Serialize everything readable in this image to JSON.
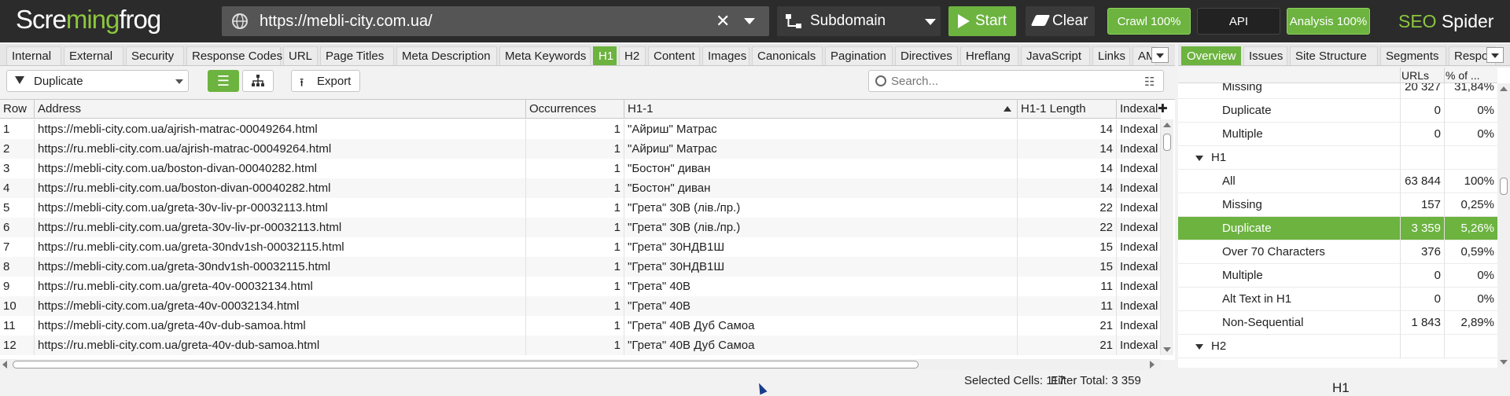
{
  "app": {
    "logo_left": "Scre",
    "logo_frog": "ming",
    "logo_right": "frog",
    "brand_seo": "SEO",
    "brand_spider": " Spider"
  },
  "topbar": {
    "url": "https://mebli-city.com.ua/",
    "mode": "Subdomain",
    "start_label": "Start",
    "clear_label": "Clear",
    "crawl_label": "Crawl 100%",
    "api_label": "API",
    "analysis_label": "Analysis 100%"
  },
  "tabs": [
    "Internal",
    "External",
    "Security",
    "Response Codes",
    "URL",
    "Page Titles",
    "Meta Description",
    "Meta Keywords",
    "H1",
    "H2",
    "Content",
    "Images",
    "Canonicals",
    "Pagination",
    "Directives",
    "Hreflang",
    "JavaScript",
    "Links",
    "AM"
  ],
  "toolbar": {
    "filter": "Duplicate",
    "export_label": "Export",
    "search_placeholder": "Search..."
  },
  "grid": {
    "columns": [
      "Row",
      "Address",
      "Occurrences",
      "H1-1",
      "H1-1 Length",
      "Indexal"
    ],
    "rows": [
      [
        "1",
        "https://mebli-city.com.ua/ajrish-matrac-00049264.html",
        "1",
        "\"Айриш\" Матрас",
        "14",
        "Indexal"
      ],
      [
        "2",
        "https://ru.mebli-city.com.ua/ajrish-matrac-00049264.html",
        "1",
        "\"Айриш\" Матрас",
        "14",
        "Indexal"
      ],
      [
        "3",
        "https://mebli-city.com.ua/boston-divan-00040282.html",
        "1",
        "\"Бостон\" диван",
        "14",
        "Indexal"
      ],
      [
        "4",
        "https://ru.mebli-city.com.ua/boston-divan-00040282.html",
        "1",
        "\"Бостон\" диван",
        "14",
        "Indexal"
      ],
      [
        "5",
        "https://mebli-city.com.ua/greta-30v-liv-pr-00032113.html",
        "1",
        "\"Грета\" 30В (лів./пр.)",
        "22",
        "Indexal"
      ],
      [
        "6",
        "https://ru.mebli-city.com.ua/greta-30v-liv-pr-00032113.html",
        "1",
        "\"Грета\" 30В (лів./пр.)",
        "22",
        "Indexal"
      ],
      [
        "7",
        "https://ru.mebli-city.com.ua/greta-30ndv1sh-00032115.html",
        "1",
        "\"Грета\" 30НДВ1Ш",
        "15",
        "Indexal"
      ],
      [
        "8",
        "https://mebli-city.com.ua/greta-30ndv1sh-00032115.html",
        "1",
        "\"Грета\" 30НДВ1Ш",
        "15",
        "Indexal"
      ],
      [
        "9",
        "https://ru.mebli-city.com.ua/greta-40v-00032134.html",
        "1",
        "\"Грета\" 40В",
        "11",
        "Indexal"
      ],
      [
        "10",
        "https://mebli-city.com.ua/greta-40v-00032134.html",
        "1",
        "\"Грета\" 40В",
        "11",
        "Indexal"
      ],
      [
        "11",
        "https://mebli-city.com.ua/greta-40v-dub-samoa.html",
        "1",
        "\"Грета\" 40В Дуб Самоа",
        "21",
        "Indexal"
      ],
      [
        "12",
        "https://ru.mebli-city.com.ua/greta-40v-dub-samoa.html",
        "1",
        "\"Грета\" 40В Дуб Самоа",
        "21",
        "Indexal"
      ]
    ]
  },
  "status": {
    "selected_cells": "Selected Cells:  117",
    "filter_total": "Filter Total:  3 359"
  },
  "right_tabs": [
    "Overview",
    "Issues",
    "Site Structure",
    "Segments",
    "Respo"
  ],
  "overview": {
    "col_urls": "URLs",
    "col_pct": "% of ...",
    "rows": [
      {
        "name": "Missing",
        "urls": "20 327",
        "pct": "31,84%",
        "level": 2
      },
      {
        "name": "Duplicate",
        "urls": "0",
        "pct": "0%",
        "level": 2
      },
      {
        "name": "Multiple",
        "urls": "0",
        "pct": "0%",
        "level": 2
      },
      {
        "name": "H1",
        "urls": "",
        "pct": "",
        "level": 1
      },
      {
        "name": "All",
        "urls": "63 844",
        "pct": "100%",
        "level": 2
      },
      {
        "name": "Missing",
        "urls": "157",
        "pct": "0,25%",
        "level": 2
      },
      {
        "name": "Duplicate",
        "urls": "3 359",
        "pct": "5,26%",
        "level": 2,
        "selected": true
      },
      {
        "name": "Over 70 Characters",
        "urls": "376",
        "pct": "0,59%",
        "level": 2
      },
      {
        "name": "Multiple",
        "urls": "0",
        "pct": "0%",
        "level": 2
      },
      {
        "name": "Alt Text in H1",
        "urls": "0",
        "pct": "0%",
        "level": 2
      },
      {
        "name": "Non-Sequential",
        "urls": "1 843",
        "pct": "2,89%",
        "level": 2
      },
      {
        "name": "H2",
        "urls": "",
        "pct": "",
        "level": 1
      }
    ],
    "chart_title": "H1"
  },
  "colors": {
    "accent": "#6cb33f",
    "topbar": "#2b2b2b",
    "cursor": "#1a3b8c"
  }
}
